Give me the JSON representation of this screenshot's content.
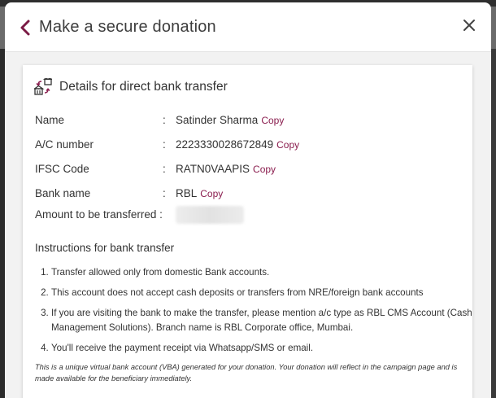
{
  "modal": {
    "title": "Make a secure donation",
    "card_title": "Details for direct bank transfer",
    "copy_label": "Copy",
    "fields": [
      {
        "label": "Name",
        "value": "Satinder Sharma"
      },
      {
        "label": "A/C number",
        "value": "2223330028672849"
      },
      {
        "label": "IFSC Code",
        "value": "RATN0VAAPIS"
      },
      {
        "label": "Bank name",
        "value": "RBL"
      }
    ],
    "amount_label": "Amount to be transferred :",
    "colon": ":",
    "instructions_title": "Instructions for bank transfer",
    "instructions": [
      "Transfer allowed only from domestic Bank accounts.",
      "This account does not accept cash deposits or transfers from NRE/foreign bank accounts",
      "If you are visiting the bank to make the transfer, please mention a/c type as RBL CMS Account (Cash Management Solutions). Branch name is RBL Corporate office, Mumbai.",
      "You'll receive the payment receipt via Whatsapp/SMS or email."
    ],
    "note": "This is a unique virtual bank account (VBA) generated for your donation. Your donation will reflect in the campaign page and is made available for the beneficiary immediately."
  },
  "icons": {
    "back": "chevron-left-icon",
    "close": "close-icon",
    "transfer": "bank-transfer-icon"
  },
  "colors": {
    "accent": "#8a1d4e",
    "text": "#333333"
  }
}
